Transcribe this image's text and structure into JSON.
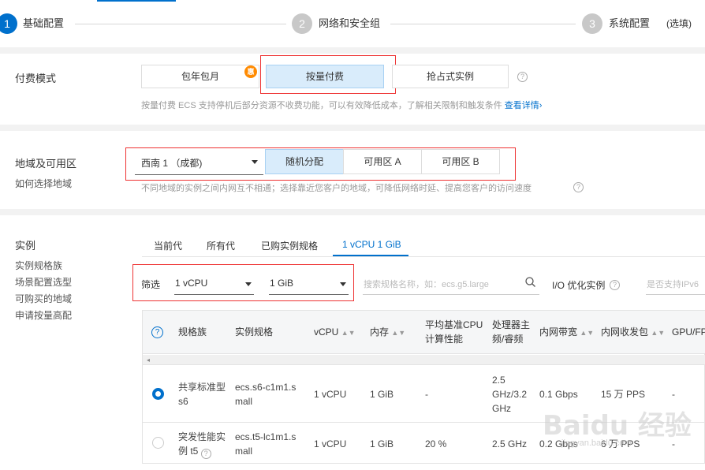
{
  "steps": [
    {
      "num": "1",
      "label": "基础配置"
    },
    {
      "num": "2",
      "label": "网络和安全组"
    },
    {
      "num": "3",
      "label": "系统配置"
    }
  ],
  "steps_optional": "(选填)",
  "billing": {
    "title": "付费模式",
    "options": [
      "包年包月",
      "按量付费",
      "抢占式实例"
    ],
    "promo_badge": "惠",
    "hint": "按量付费 ECS 支持停机后部分资源不收费功能，可以有效降低成本，了解相关限制和触发条件",
    "detail_link": "查看详情›"
  },
  "region": {
    "title": "地域及可用区",
    "sub_link": "如何选择地域",
    "selected_region": "西南 1 （成都)",
    "zones": [
      "随机分配",
      "可用区 A",
      "可用区 B"
    ],
    "hint": "不同地域的实例之间内网互不相通；选择靠近您客户的地域，可降低网络时延、提高您客户的访问速度"
  },
  "instance": {
    "title": "实例",
    "side_links": [
      "实例规格族",
      "场景配置选型",
      "可购买的地域",
      "申请按量高配"
    ],
    "tabs": [
      "当前代",
      "所有代",
      "已购实例规格",
      "1 vCPU 1 GiB"
    ],
    "filter_label": "筛选",
    "vcpu_value": "1 vCPU",
    "mem_value": "1 GiB",
    "search_placeholder": "搜索规格名称，如：ecs.g5.large",
    "io_label": "I/O 优化实例",
    "ipv6_placeholder": "是否支持IPv6",
    "table": {
      "headers": [
        "规格族",
        "实例规格",
        "vCPU",
        "内存",
        "平均基准CPU计算性能",
        "处理器主频/睿频",
        "内网带宽",
        "内网收发包",
        "GPU/FP"
      ],
      "rows": [
        {
          "selected": true,
          "family": "共享标准型 s6",
          "spec": "ecs.s6-c1m1.small",
          "vcpu": "1 vCPU",
          "mem": "1 GiB",
          "baseline": "-",
          "freq": "2.5 GHz/3.2 GHz",
          "bandwidth": "0.1 Gbps",
          "pps": "15 万 PPS",
          "gpu": "-"
        },
        {
          "selected": false,
          "family": "突发性能实例 t5",
          "spec": "ecs.t5-lc1m1.small",
          "vcpu": "1 vCPU",
          "mem": "1 GiB",
          "baseline": "20 %",
          "freq": "2.5 GHz",
          "bandwidth": "0.2 Gbps",
          "pps": "6 万 PPS",
          "gpu": "-"
        }
      ]
    }
  },
  "watermark": "Baidu 经验",
  "watermark_url": "jingyan.baidu.com",
  "colors": {
    "primary": "#0070cc",
    "step_inactive": "#c8c8c8",
    "red_highlight": "#e33333",
    "promo": "#ff8a00"
  }
}
